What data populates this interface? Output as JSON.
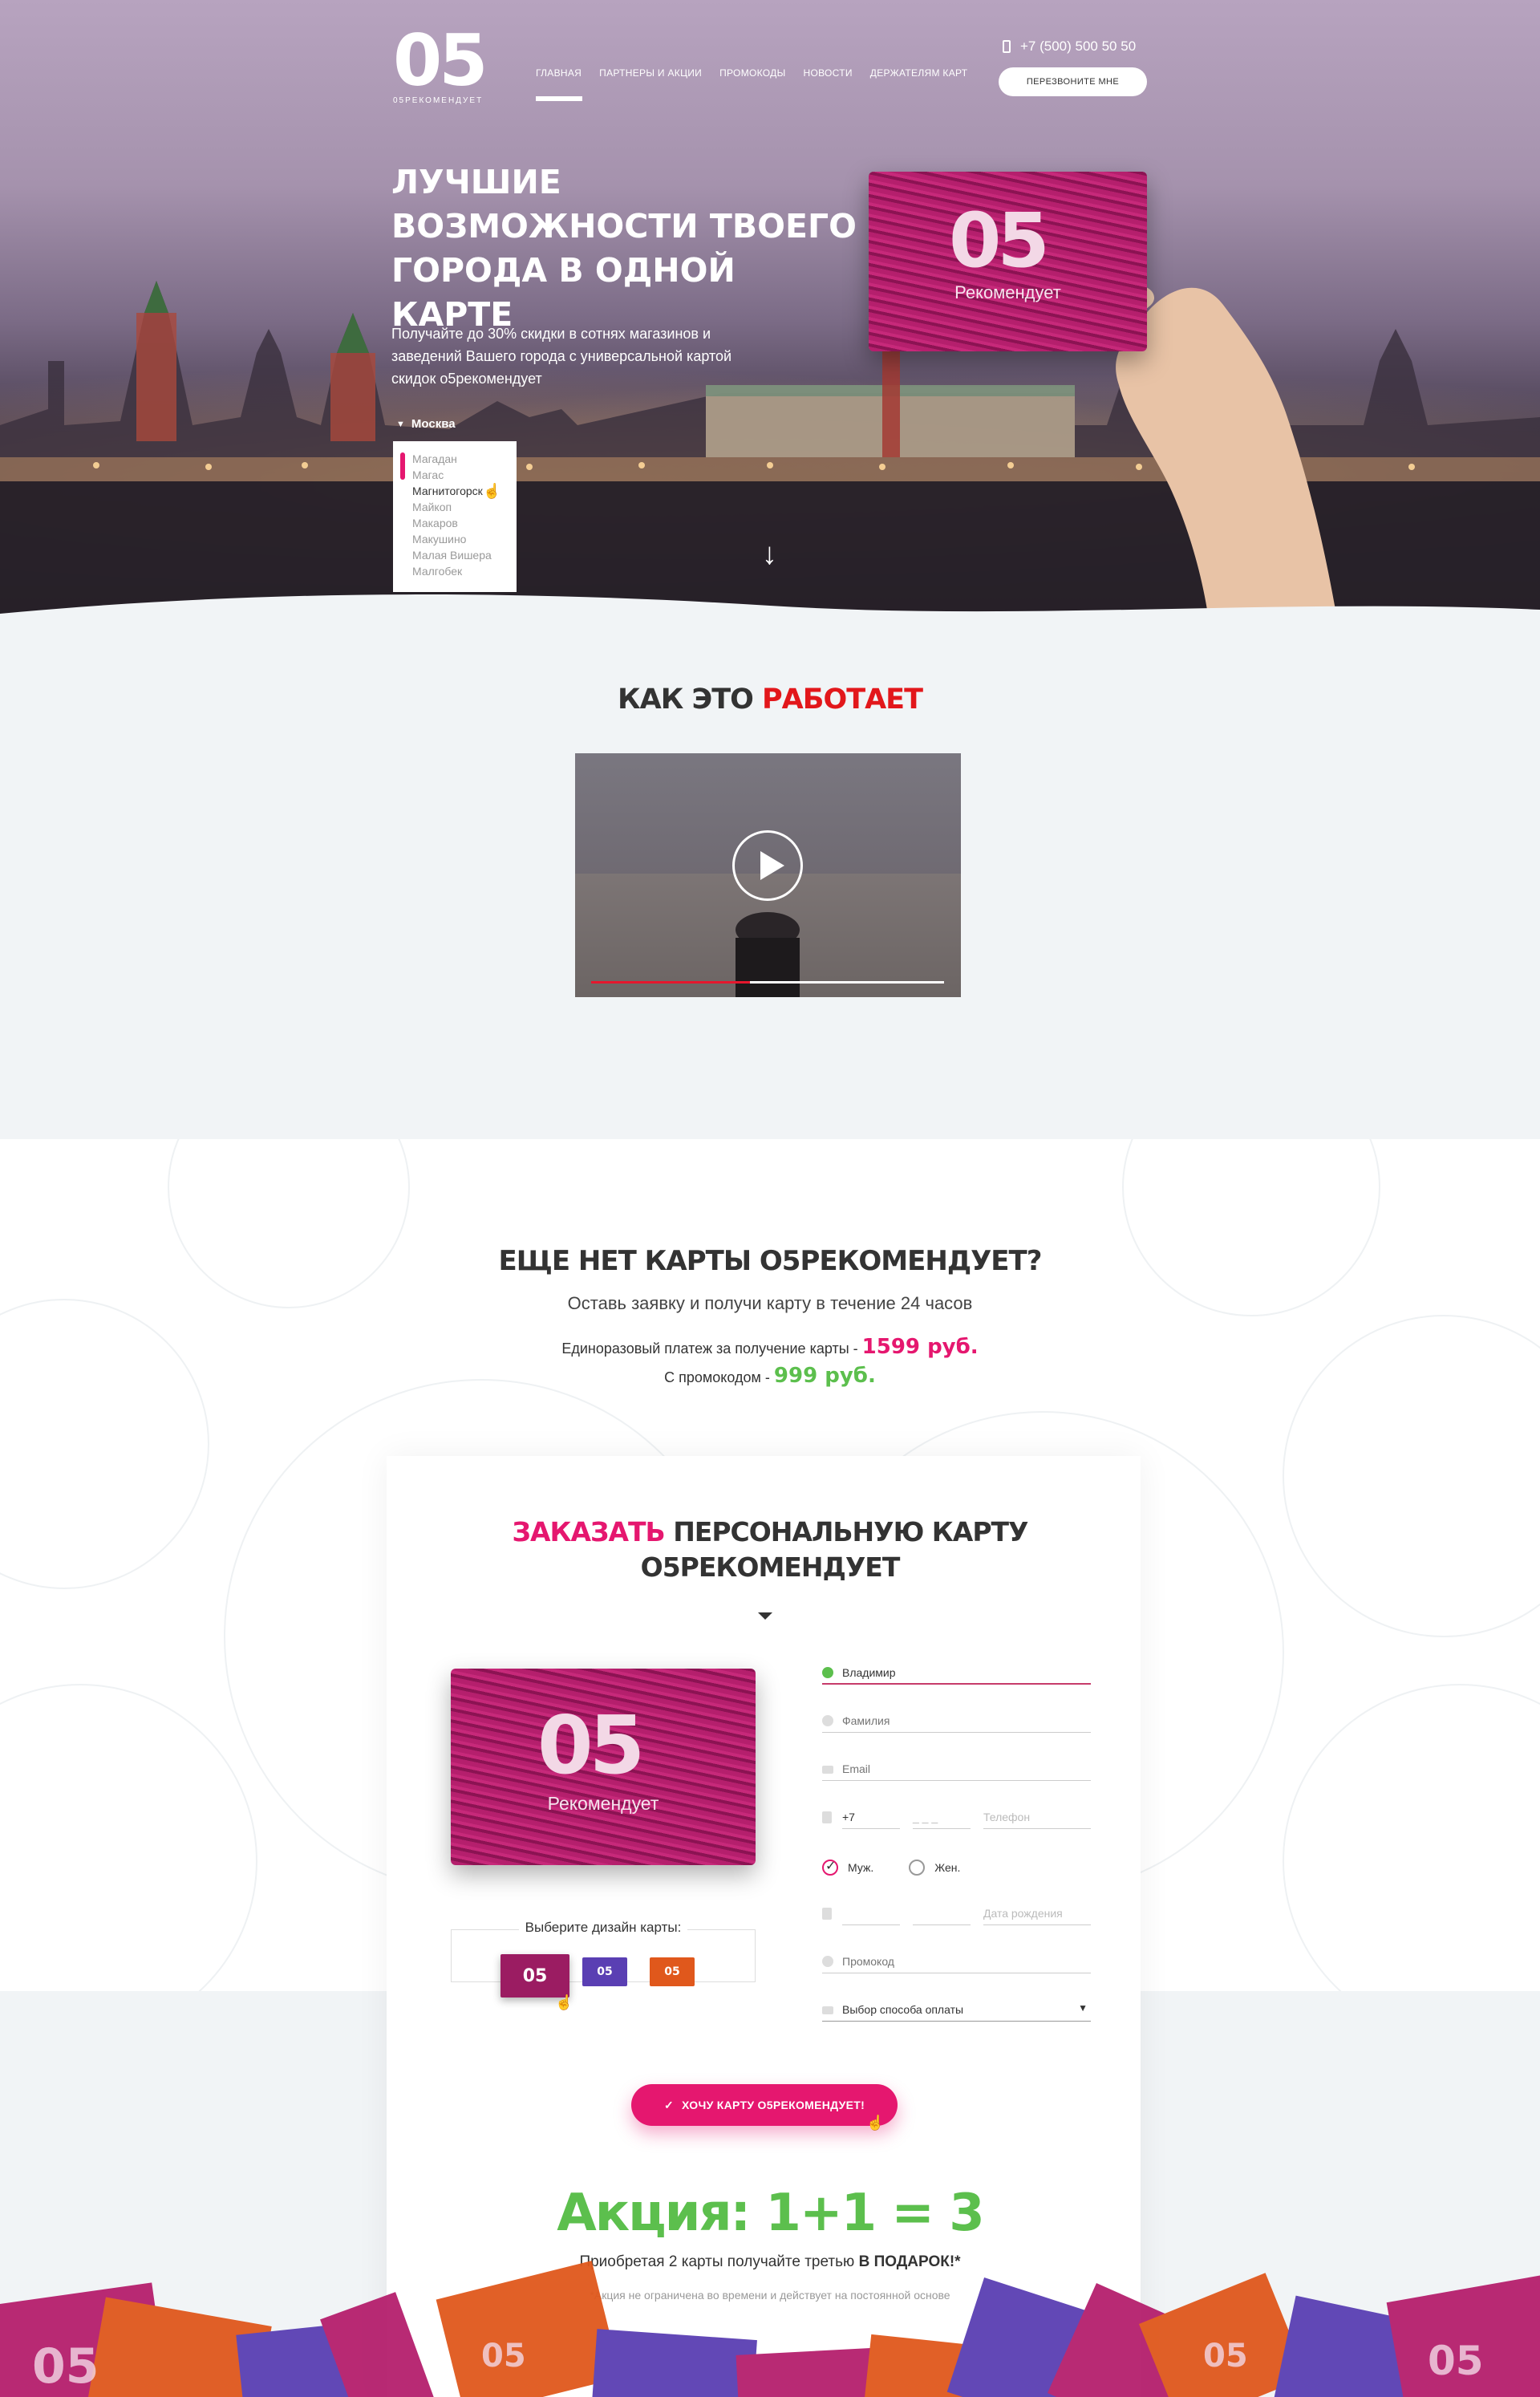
{
  "header": {
    "logo_big": "05",
    "logo_small": "05РЕКОМЕНДУЕТ",
    "nav": [
      "ГЛАВНАЯ",
      "ПАРТНЕРЫ И АКЦИИ",
      "ПРОМОКОДЫ",
      "НОВОСТИ",
      "ДЕРЖАТЕЛЯМ КАРТ"
    ],
    "phone": "+7 (500) 500 50 50",
    "callback_label": "ПЕРЕЗВОНИТЕ МНЕ"
  },
  "hero": {
    "title": "ЛУЧШИЕ ВОЗМОЖНОСТИ ТВОЕГО ГОРОДА В ОДНОЙ КАРТЕ",
    "subtitle": "Получайте до 30% скидки в сотнях магазинов и заведений Вашего города с универсальной картой скидок о5рекомендует",
    "city": "Москва",
    "city_options": [
      "Магадан",
      "Магас",
      "Магнитогорск",
      "Майкоп",
      "Макаров",
      "Макушино",
      "Малая Вишера",
      "Малгобек"
    ],
    "city_selected_index": 2,
    "card_logo": "05",
    "card_text": "Рекомендует"
  },
  "how": {
    "title_a": "КАК ЭТО",
    "title_b": "РАБОТАЕТ",
    "video_progress": 0.45
  },
  "order": {
    "question": "ЕЩЕ НЕТ КАРТЫ О5РЕКОМЕНДУЕТ?",
    "subtitle": "Оставь заявку и получи карту в течение 24 часов",
    "price_label": "Единоразовый платеж за получение карты -",
    "price": "1599 руб.",
    "promo_label": "С промокодом -",
    "promo_price": "999 руб.",
    "panel_title_a": "ЗАКАЗАТЬ",
    "panel_title_b": "ПЕРСОНАЛЬНУЮ КАРТУ",
    "panel_title_c": "О5РЕКОМЕНДУЕТ",
    "card_logo": "05",
    "card_text": "Рекомендует",
    "design_label": "Выберите дизайн карты:",
    "designs": [
      "05",
      "05",
      "05"
    ],
    "form": {
      "first_name": "Владимир",
      "last_name_placeholder": "Фамилия",
      "email_placeholder": "Email",
      "phone_code": "+7",
      "phone_area": "_ _ _",
      "phone_placeholder": "Телефон",
      "gender_male": "Муж.",
      "gender_female": "Жен.",
      "birthday_placeholder": "Дата рождения",
      "promo_placeholder": "Промокод",
      "payment_placeholder": "Выбор способа оплаты"
    },
    "submit_label": "ХОЧУ КАРТУ О5РЕКОМЕНДУЕТ!"
  },
  "promo": {
    "title": "Акция: 1+1 = 3",
    "subtitle_a": "Приобретая 2 карты получайте третью",
    "subtitle_b": "В ПОДАРОК!*",
    "note": "*Акция не ограничена во времени и действует на постоянной основе"
  },
  "colors": {
    "accent_pink": "#e5176f",
    "accent_red": "#e2171b",
    "accent_green": "#5cbf4d",
    "card_purple": "#5a3fb3",
    "card_orange": "#e0581c"
  }
}
